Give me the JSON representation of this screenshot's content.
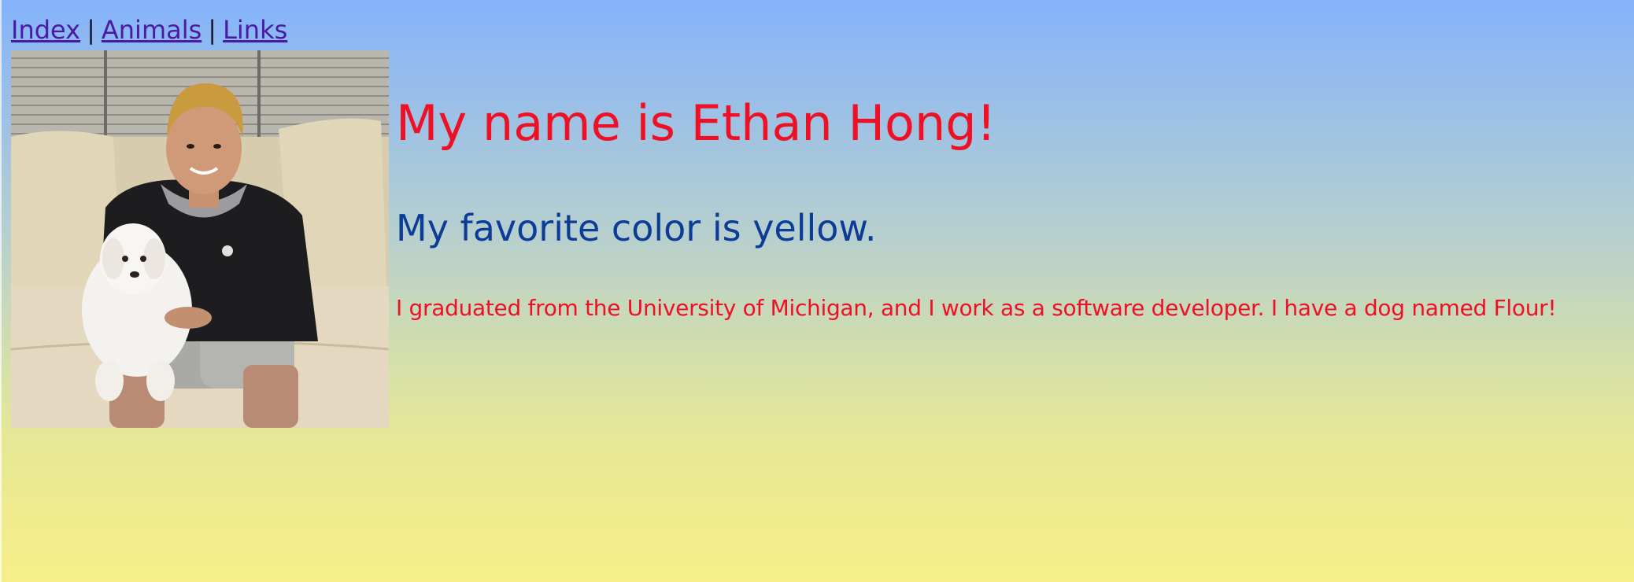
{
  "nav": {
    "links": [
      "Index",
      "Animals",
      "Links"
    ],
    "separator": "|"
  },
  "photo": {
    "alt": "Ethan Hong with dog Flour"
  },
  "heading": "My name is Ethan Hong!",
  "subheading": "My favorite color is yellow.",
  "bio": "I graduated from the University of Michigan, and I work as a software developer. I have a dog named Flour!",
  "colors": {
    "heading": "#ee1024",
    "subheading": "#0d3c96",
    "link": "#4a1aa0",
    "gradient_top": "#84b3fb",
    "gradient_bottom": "#f7ee88"
  }
}
